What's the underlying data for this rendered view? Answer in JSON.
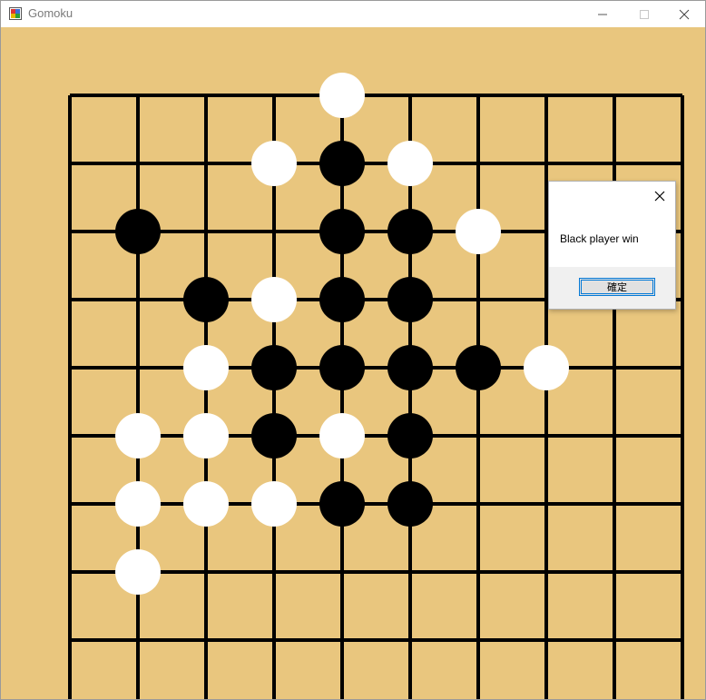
{
  "window": {
    "title": "Gomoku",
    "icon": "app-icon",
    "controls": [
      "minimize-icon",
      "maximize-icon",
      "close-icon"
    ]
  },
  "board": {
    "size": 9,
    "background_color": "#e9c67e",
    "line_color": "#000000",
    "stones": [
      {
        "col": 4,
        "row": 0,
        "color": "white"
      },
      {
        "col": 3,
        "row": 1,
        "color": "white"
      },
      {
        "col": 4,
        "row": 1,
        "color": "black"
      },
      {
        "col": 5,
        "row": 1,
        "color": "white"
      },
      {
        "col": 1,
        "row": 2,
        "color": "black"
      },
      {
        "col": 4,
        "row": 2,
        "color": "black"
      },
      {
        "col": 5,
        "row": 2,
        "color": "black"
      },
      {
        "col": 6,
        "row": 2,
        "color": "white"
      },
      {
        "col": 2,
        "row": 3,
        "color": "black"
      },
      {
        "col": 3,
        "row": 3,
        "color": "white"
      },
      {
        "col": 4,
        "row": 3,
        "color": "black"
      },
      {
        "col": 5,
        "row": 3,
        "color": "black"
      },
      {
        "col": 2,
        "row": 4,
        "color": "white"
      },
      {
        "col": 3,
        "row": 4,
        "color": "black"
      },
      {
        "col": 4,
        "row": 4,
        "color": "black"
      },
      {
        "col": 5,
        "row": 4,
        "color": "black"
      },
      {
        "col": 6,
        "row": 4,
        "color": "black"
      },
      {
        "col": 7,
        "row": 4,
        "color": "white"
      },
      {
        "col": 1,
        "row": 5,
        "color": "white"
      },
      {
        "col": 2,
        "row": 5,
        "color": "white"
      },
      {
        "col": 3,
        "row": 5,
        "color": "black"
      },
      {
        "col": 4,
        "row": 5,
        "color": "white"
      },
      {
        "col": 5,
        "row": 5,
        "color": "black"
      },
      {
        "col": 1,
        "row": 6,
        "color": "white"
      },
      {
        "col": 2,
        "row": 6,
        "color": "white"
      },
      {
        "col": 3,
        "row": 6,
        "color": "white"
      },
      {
        "col": 4,
        "row": 6,
        "color": "black"
      },
      {
        "col": 5,
        "row": 6,
        "color": "black"
      },
      {
        "col": 1,
        "row": 7,
        "color": "white"
      }
    ]
  },
  "dialog": {
    "message": "Black player win",
    "ok_label": "確定",
    "ok_border_color": "#0078d7"
  }
}
